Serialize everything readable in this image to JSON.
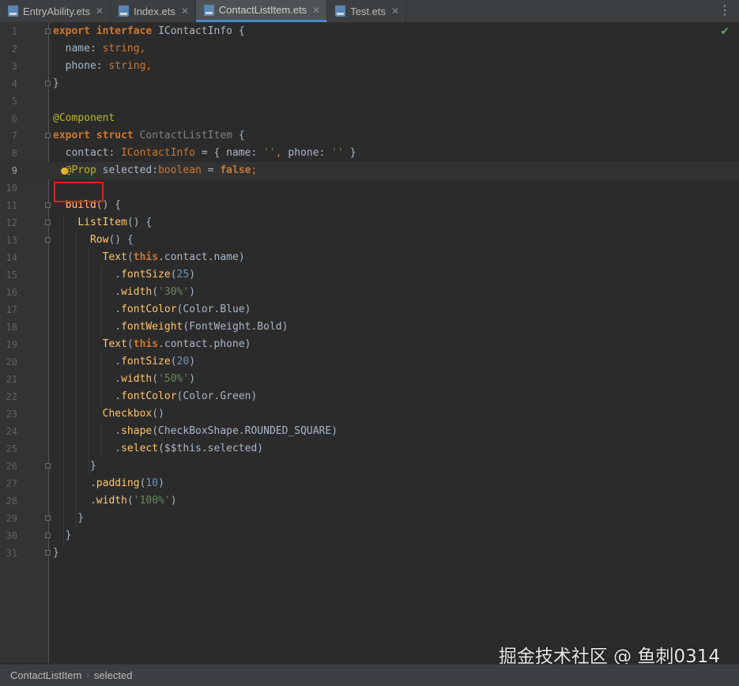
{
  "tabs": [
    {
      "label": "EntryAbility.ets",
      "icon": "ets-file-icon",
      "active": false
    },
    {
      "label": "Index.ets",
      "icon": "ets-file-icon",
      "active": false
    },
    {
      "label": "ContactListItem.ets",
      "icon": "ets-file-icon",
      "active": true
    },
    {
      "label": "Test.ets",
      "icon": "ets-file-icon",
      "active": false
    }
  ],
  "tab_menu_icon": "⋮",
  "inspection_icon": "✔",
  "editor": {
    "current_line": 9,
    "lines": [
      {
        "num": "1",
        "segs": [
          [
            "k",
            "export"
          ],
          [
            "p",
            " "
          ],
          [
            "k",
            "interface"
          ],
          [
            "p",
            " IContactInfo {"
          ]
        ]
      },
      {
        "num": "2",
        "segs": [
          [
            "p",
            "  name: "
          ],
          [
            "t",
            "string"
          ],
          [
            "t",
            ","
          ]
        ]
      },
      {
        "num": "3",
        "segs": [
          [
            "p",
            "  phone: "
          ],
          [
            "t",
            "string"
          ],
          [
            "t",
            ","
          ]
        ]
      },
      {
        "num": "4",
        "segs": [
          [
            "p",
            "}"
          ]
        ]
      },
      {
        "num": "5",
        "segs": []
      },
      {
        "num": "6",
        "segs": [
          [
            "a",
            "@Component"
          ]
        ]
      },
      {
        "num": "7",
        "segs": [
          [
            "k",
            "export"
          ],
          [
            "p",
            " "
          ],
          [
            "k",
            "struct"
          ],
          [
            "p",
            " "
          ],
          [
            "g",
            "ContactListItem"
          ],
          [
            "p",
            " {"
          ]
        ]
      },
      {
        "num": "8",
        "segs": [
          [
            "p",
            "  contact: "
          ],
          [
            "t",
            "IContactInfo"
          ],
          [
            "p",
            " = { name: "
          ],
          [
            "s",
            "''"
          ],
          [
            "t",
            ","
          ],
          [
            "p",
            " phone: "
          ],
          [
            "s",
            "''"
          ],
          [
            "p",
            " }"
          ]
        ]
      },
      {
        "num": "9",
        "segs": [
          [
            "p",
            "  "
          ],
          [
            "a",
            "@Prop"
          ],
          [
            "p",
            " selected:"
          ],
          [
            "t",
            "boolean"
          ],
          [
            "p",
            " = "
          ],
          [
            "k",
            "false"
          ],
          [
            "t",
            ";"
          ]
        ]
      },
      {
        "num": "10",
        "segs": []
      },
      {
        "num": "11",
        "segs": [
          [
            "p",
            "  "
          ],
          [
            "f",
            "build"
          ],
          [
            "p",
            "() {"
          ]
        ]
      },
      {
        "num": "12",
        "segs": [
          [
            "p",
            "    "
          ],
          [
            "f",
            "ListItem"
          ],
          [
            "p",
            "() {"
          ]
        ]
      },
      {
        "num": "13",
        "segs": [
          [
            "p",
            "      "
          ],
          [
            "f",
            "Row"
          ],
          [
            "p",
            "() {"
          ]
        ]
      },
      {
        "num": "14",
        "segs": [
          [
            "p",
            "        "
          ],
          [
            "f",
            "Text"
          ],
          [
            "p",
            "("
          ],
          [
            "k",
            "this"
          ],
          [
            "p",
            ".contact.name)"
          ]
        ]
      },
      {
        "num": "15",
        "segs": [
          [
            "p",
            "          ."
          ],
          [
            "f",
            "fontSize"
          ],
          [
            "p",
            "("
          ],
          [
            "n",
            "25"
          ],
          [
            "p",
            ")"
          ]
        ]
      },
      {
        "num": "16",
        "segs": [
          [
            "p",
            "          ."
          ],
          [
            "f",
            "width"
          ],
          [
            "p",
            "("
          ],
          [
            "s",
            "'30%'"
          ],
          [
            "p",
            ")"
          ]
        ]
      },
      {
        "num": "17",
        "segs": [
          [
            "p",
            "          ."
          ],
          [
            "f",
            "fontColor"
          ],
          [
            "p",
            "(Color.Blue)"
          ]
        ]
      },
      {
        "num": "18",
        "segs": [
          [
            "p",
            "          ."
          ],
          [
            "f",
            "fontWeight"
          ],
          [
            "p",
            "(FontWeight.Bold)"
          ]
        ]
      },
      {
        "num": "19",
        "segs": [
          [
            "p",
            "        "
          ],
          [
            "f",
            "Text"
          ],
          [
            "p",
            "("
          ],
          [
            "k",
            "this"
          ],
          [
            "p",
            ".contact.phone)"
          ]
        ]
      },
      {
        "num": "20",
        "segs": [
          [
            "p",
            "          ."
          ],
          [
            "f",
            "fontSize"
          ],
          [
            "p",
            "("
          ],
          [
            "n",
            "20"
          ],
          [
            "p",
            ")"
          ]
        ]
      },
      {
        "num": "21",
        "segs": [
          [
            "p",
            "          ."
          ],
          [
            "f",
            "width"
          ],
          [
            "p",
            "("
          ],
          [
            "s",
            "'50%'"
          ],
          [
            "p",
            ")"
          ]
        ]
      },
      {
        "num": "22",
        "segs": [
          [
            "p",
            "          ."
          ],
          [
            "f",
            "fontColor"
          ],
          [
            "p",
            "(Color.Green)"
          ]
        ]
      },
      {
        "num": "23",
        "segs": [
          [
            "p",
            "        "
          ],
          [
            "f",
            "Checkbox"
          ],
          [
            "p",
            "()"
          ]
        ]
      },
      {
        "num": "24",
        "segs": [
          [
            "p",
            "          ."
          ],
          [
            "f",
            "shape"
          ],
          [
            "p",
            "(CheckBoxShape.ROUNDED_SQUARE)"
          ]
        ]
      },
      {
        "num": "25",
        "segs": [
          [
            "p",
            "          ."
          ],
          [
            "f",
            "select"
          ],
          [
            "p",
            "($$this.selected)"
          ]
        ]
      },
      {
        "num": "26",
        "segs": [
          [
            "p",
            "      }"
          ]
        ]
      },
      {
        "num": "27",
        "segs": [
          [
            "p",
            "      ."
          ],
          [
            "f",
            "padding"
          ],
          [
            "p",
            "("
          ],
          [
            "n",
            "10"
          ],
          [
            "p",
            ")"
          ]
        ]
      },
      {
        "num": "28",
        "segs": [
          [
            "p",
            "      ."
          ],
          [
            "f",
            "width"
          ],
          [
            "p",
            "("
          ],
          [
            "s",
            "'100%'"
          ],
          [
            "p",
            ")"
          ]
        ]
      },
      {
        "num": "29",
        "segs": [
          [
            "p",
            "    }"
          ]
        ]
      },
      {
        "num": "30",
        "segs": [
          [
            "p",
            "  }"
          ]
        ]
      },
      {
        "num": "31",
        "segs": [
          [
            "p",
            "}"
          ]
        ]
      }
    ]
  },
  "watermark": "掘金技术社区 @ 鱼刺0314",
  "breadcrumb": [
    "ContactListItem",
    "selected"
  ],
  "breadcrumb_separator": "›"
}
